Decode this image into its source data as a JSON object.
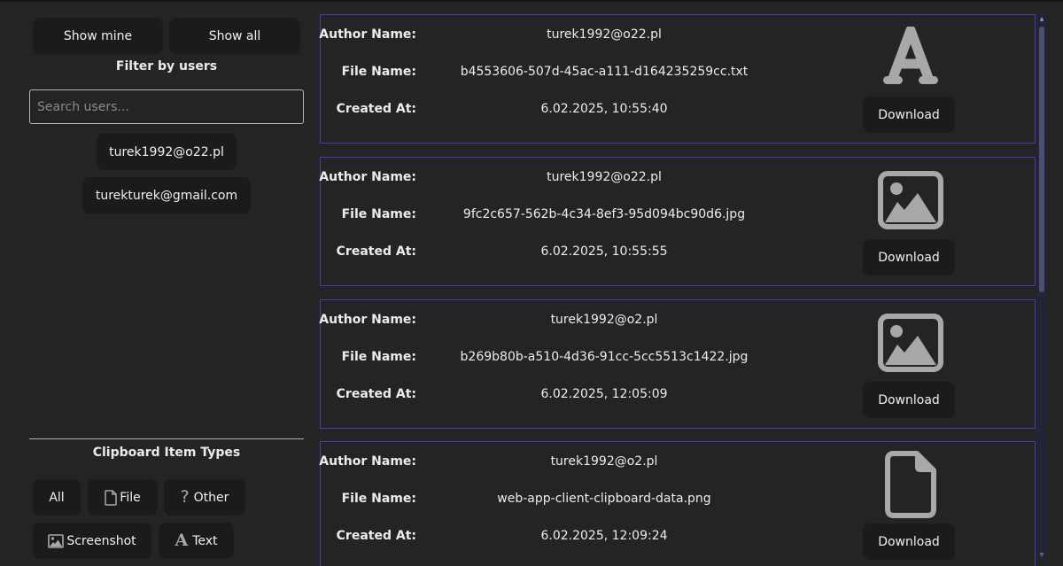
{
  "sidebar": {
    "show_mine_label": "Show mine",
    "show_all_label": "Show all",
    "filter_title": "Filter by users",
    "search_placeholder": "Search users...",
    "search_value": "",
    "users": [
      "turek1992@o22.pl",
      "turekturek@gmail.com"
    ],
    "types_title": "Clipboard Item Types",
    "types": [
      {
        "label": "All",
        "icon": ""
      },
      {
        "label": "File",
        "icon": "file-icon"
      },
      {
        "label": "Other",
        "icon": "question-icon"
      },
      {
        "label": "Screenshot",
        "icon": "image-icon"
      },
      {
        "label": "Text",
        "icon": "text-icon"
      }
    ]
  },
  "labels": {
    "author": "Author Name:",
    "file": "File Name:",
    "created": "Created At:",
    "download": "Download"
  },
  "items": [
    {
      "author": "turek1992@o22.pl",
      "file_name": "b4553606-507d-45ac-a111-d164235259cc.txt",
      "created_at": "6.02.2025, 10:55:40",
      "icon": "text-icon"
    },
    {
      "author": "turek1992@o22.pl",
      "file_name": "9fc2c657-562b-4c34-8ef3-95d094bc90d6.jpg",
      "created_at": "6.02.2025, 10:55:55",
      "icon": "image-icon"
    },
    {
      "author": "turek1992@o2.pl",
      "file_name": "b269b80b-a510-4d36-91cc-5cc5513c1422.jpg",
      "created_at": "6.02.2025, 12:05:09",
      "icon": "image-icon"
    },
    {
      "author": "turek1992@o2.pl",
      "file_name": "web-app-client-clipboard-data.png",
      "created_at": "6.02.2025, 12:09:24",
      "icon": "file-icon"
    }
  ],
  "colors": {
    "background": "#242424",
    "button": "#1b1b1b",
    "card_border": "#4b3bb0",
    "icon": "#a8a8a8",
    "scrollbar_track": "#232536",
    "scrollbar_thumb": "#4a5070"
  }
}
